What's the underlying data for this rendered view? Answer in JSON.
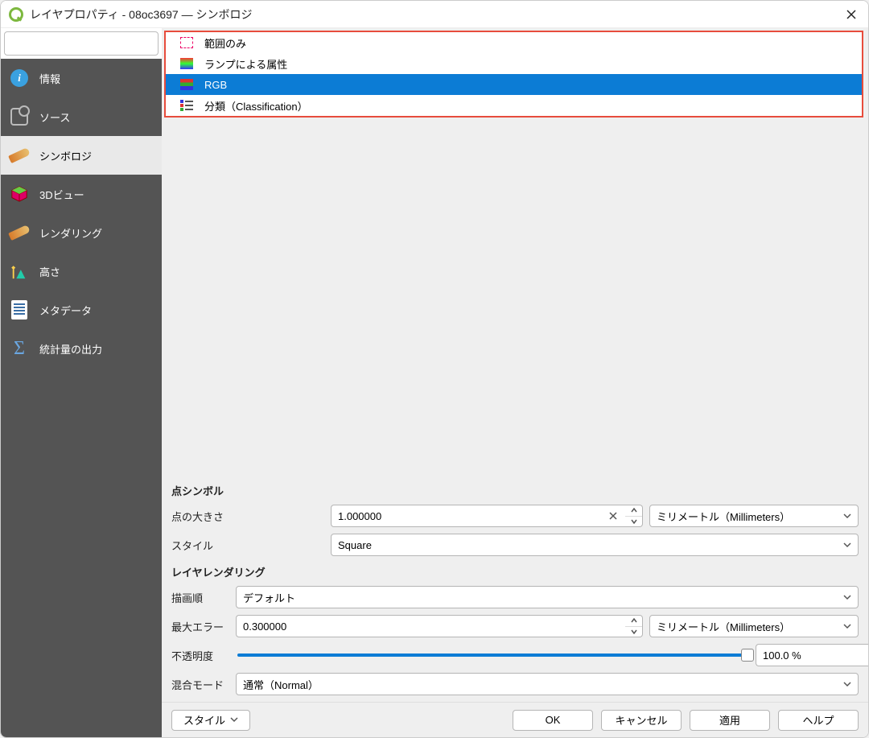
{
  "window": {
    "title": "レイヤプロパティ - 08oc3697 — シンボロジ"
  },
  "search": {
    "placeholder": ""
  },
  "sidebar": {
    "items": [
      {
        "label": "情報"
      },
      {
        "label": "ソース"
      },
      {
        "label": "シンボロジ"
      },
      {
        "label": "3Dビュー"
      },
      {
        "label": "レンダリング"
      },
      {
        "label": "高さ"
      },
      {
        "label": "メタデータ"
      },
      {
        "label": "統計量の出力"
      }
    ],
    "active_index": 2
  },
  "render_types": {
    "items": [
      {
        "label": "範囲のみ"
      },
      {
        "label": "ランプによる属性"
      },
      {
        "label": "RGB"
      },
      {
        "label": "分類（Classification）"
      }
    ],
    "selected_index": 2
  },
  "point_symbol": {
    "heading": "点シンボル",
    "size_label": "点の大きさ",
    "size_value": "1.000000",
    "size_unit": "ミリメートル（Millimeters）",
    "style_label": "スタイル",
    "style_value": "Square"
  },
  "layer_rendering": {
    "heading": "レイヤレンダリング",
    "draw_order_label": "描画順",
    "draw_order_value": "デフォルト",
    "max_error_label": "最大エラー",
    "max_error_value": "0.300000",
    "max_error_unit": "ミリメートル（Millimeters）",
    "opacity_label": "不透明度",
    "opacity_value": "100.0 %",
    "opacity_percent": 100,
    "blend_label": "混合モード",
    "blend_value": "通常（Normal）"
  },
  "footer": {
    "style": "スタイル",
    "ok": "OK",
    "cancel": "キャンセル",
    "apply": "適用",
    "help": "ヘルプ"
  }
}
